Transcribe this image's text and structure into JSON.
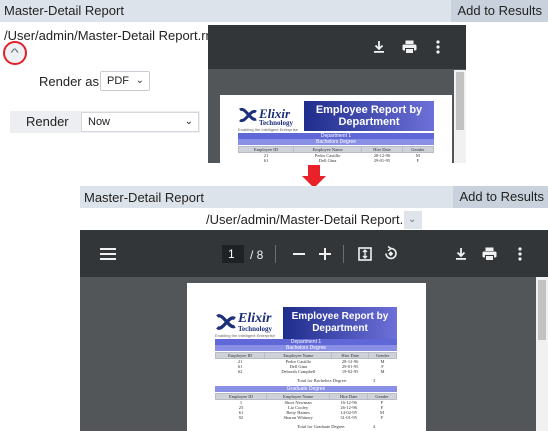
{
  "top": {
    "title": "Master-Detail Report",
    "add_to_results": "Add to Results",
    "path": "/User/admin/Master-Detail Report.rml",
    "render_as_label": "Render as",
    "format_value": "PDF",
    "render_label": "Render",
    "when_value": "Now"
  },
  "bottom": {
    "title": "Master-Detail Report",
    "add_to_results": "Add to Results",
    "path": "/User/admin/Master-Detail Report.rml",
    "page_current": "1",
    "page_total": "/ 8"
  },
  "report": {
    "company": "Elixir",
    "company_sub": "Technology",
    "tagline": "Enabling the Intelligent Enterprise",
    "title_line1": "Employee Report by",
    "title_line2": "Department",
    "department": "Department 1",
    "columns": [
      "Employee ID",
      "Employee Name",
      "Hire Date",
      "Gender"
    ],
    "groups": [
      {
        "name": "Bachelors Degree",
        "rows": [
          [
            "21",
            "Pedro Castillo",
            "28-12-96",
            "M"
          ],
          [
            "61",
            "Dell Gina",
            "29-01-95",
            "F"
          ],
          [
            "62",
            "Deborah Campbell",
            "19-02-95",
            "M"
          ]
        ],
        "total_label": "Total for Bachelors Degree:",
        "total_value": "3"
      },
      {
        "name": "Graduate Degree",
        "rows": [
          [
            "1",
            "Short Newman",
            "16-12-96",
            "F"
          ],
          [
            "25",
            "Liz Cooley",
            "26-12-96",
            "F"
          ],
          [
            "61",
            "Betty Haines",
            "14-02-95",
            "M"
          ],
          [
            "92",
            "Sharon Whitney",
            "31-01-95",
            "F"
          ]
        ],
        "total_label": "Total for Graduate Degree:",
        "total_value": "4"
      }
    ]
  },
  "icons": {
    "collapse": "chevron-up-icon",
    "download": "download-icon",
    "print": "print-icon",
    "more": "more-vert-icon",
    "menu": "menu-icon",
    "zoom_out": "minus-icon",
    "zoom_in": "plus-icon",
    "fit": "fit-page-icon",
    "rotate": "rotate-icon",
    "arrow": "red-down-arrow"
  },
  "colors": {
    "accent_red": "#e8212b",
    "header_bg": "#dde3ea",
    "viewer_toolbar": "#323639",
    "viewer_bg": "#525659",
    "banner_blue": "#1f2d8c"
  }
}
